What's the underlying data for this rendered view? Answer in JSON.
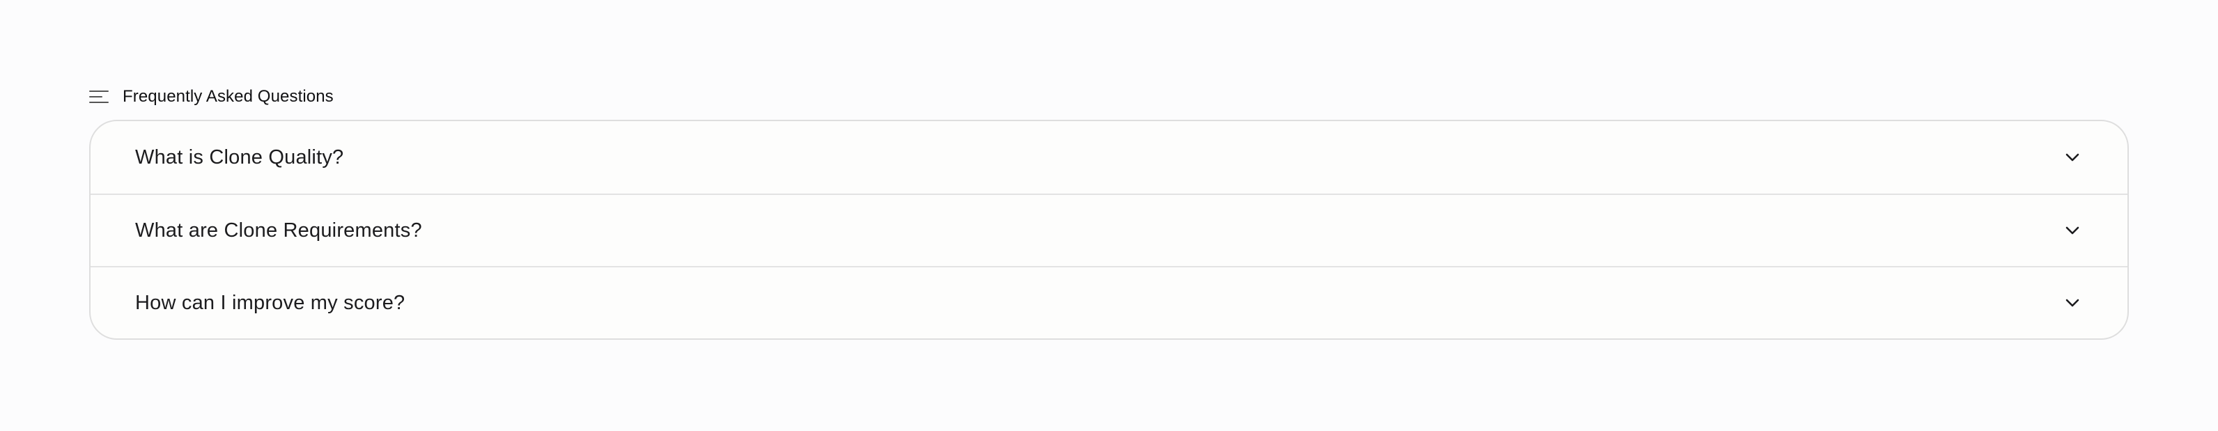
{
  "faq": {
    "header": {
      "icon": "menu-lines-icon",
      "title": "Frequently Asked Questions"
    },
    "items": [
      {
        "question": "What is Clone Quality?",
        "icon": "chevron-down-icon",
        "expanded": false
      },
      {
        "question": "What are Clone Requirements?",
        "icon": "chevron-down-icon",
        "expanded": false
      },
      {
        "question": "How can I improve my score?",
        "icon": "chevron-down-icon",
        "expanded": false
      }
    ]
  },
  "colors": {
    "background": "#fcfcfd",
    "card_background": "#fdfdfc",
    "border": "#dedede",
    "text": "#1c1c1e"
  }
}
